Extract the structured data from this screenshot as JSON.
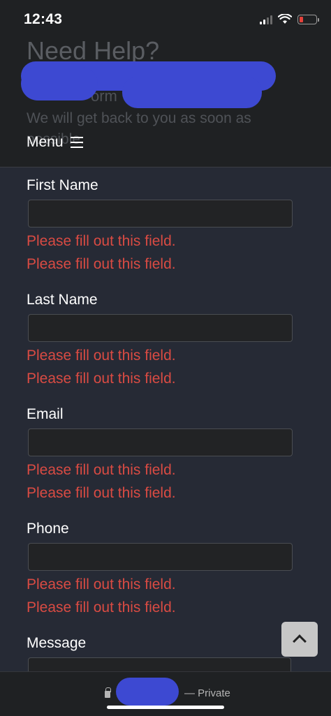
{
  "status_bar": {
    "time": "12:43"
  },
  "header": {
    "title": "Need Help?",
    "subtitle_fragment": "orm",
    "description": "We will get back to you as soon as possible.",
    "menu_label": "Menu"
  },
  "form": {
    "error_message": "Please fill out this field.",
    "fields": [
      {
        "label": "First Name",
        "value": "",
        "errors": [
          "Please fill out this field.",
          "Please fill out this field."
        ]
      },
      {
        "label": "Last Name",
        "value": "",
        "errors": [
          "Please fill out this field.",
          "Please fill out this field."
        ]
      },
      {
        "label": "Email",
        "value": "",
        "errors": [
          "Please fill out this field.",
          "Please fill out this field."
        ]
      },
      {
        "label": "Phone",
        "value": "",
        "errors": [
          "Please fill out this field.",
          "Please fill out this field."
        ]
      },
      {
        "label": "Message",
        "value": "",
        "errors": []
      }
    ]
  },
  "browser_bar": {
    "privacy_label": "— Private"
  },
  "colors": {
    "page_background": "#262a35",
    "header_background": "#1f2123",
    "error": "#d94b43",
    "redaction": "#3d49d2",
    "back_to_top": "#c7c7c7"
  },
  "icons": {
    "menu": "hamburger-icon",
    "back_to_top": "chevron-up-icon",
    "lock": "lock-icon"
  }
}
